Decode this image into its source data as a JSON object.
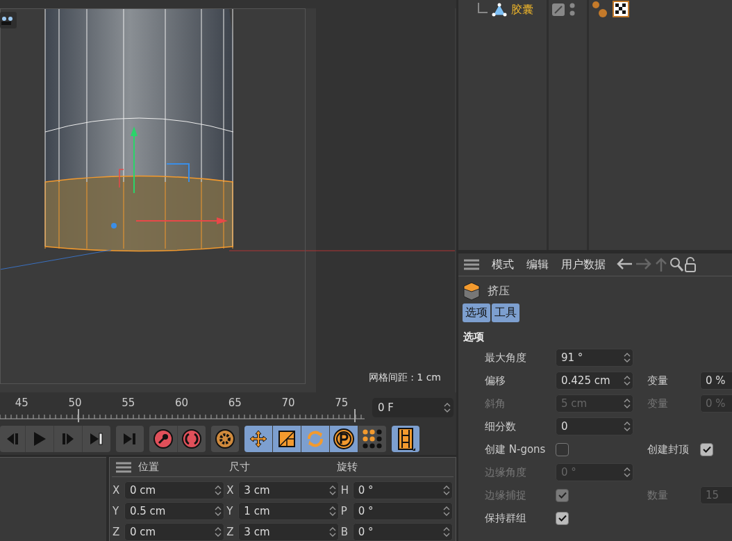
{
  "object_manager": {
    "object": {
      "name": "胶囊"
    }
  },
  "viewport": {
    "grid_label": "网格间距 : 1 cm"
  },
  "timeline": {
    "ticks": [
      "45",
      "50",
      "55",
      "60",
      "65",
      "70",
      "75"
    ],
    "frame_field": "0 F"
  },
  "transport": {
    "groups": [
      [
        {
          "kind": "prev-key",
          "selected": false
        },
        {
          "kind": "play",
          "selected": false
        },
        {
          "kind": "next-key",
          "selected": false
        },
        {
          "kind": "goto-end",
          "selected": false
        }
      ],
      [
        {
          "kind": "goto-last",
          "selected": false
        }
      ],
      [
        {
          "kind": "record-key",
          "selected": false
        },
        {
          "kind": "auto-key",
          "selected": false
        }
      ],
      [
        {
          "kind": "gear",
          "selected": false
        }
      ],
      [
        {
          "kind": "move",
          "selected": true
        },
        {
          "kind": "scale",
          "selected": true
        },
        {
          "kind": "rotate",
          "selected": true
        },
        {
          "kind": "param",
          "selected": true
        },
        {
          "kind": "points",
          "selected": false
        }
      ],
      [
        {
          "kind": "film",
          "selected": true
        }
      ]
    ]
  },
  "coordinates": {
    "headers": [
      "位置",
      "尺寸",
      "旋转"
    ],
    "rows": [
      [
        {
          "axis": "X",
          "value": "0 cm"
        },
        {
          "axis": "X",
          "value": "3 cm"
        },
        {
          "axis": "H",
          "value": "0 °"
        }
      ],
      [
        {
          "axis": "Y",
          "value": "0.5 cm"
        },
        {
          "axis": "Y",
          "value": "1 cm"
        },
        {
          "axis": "P",
          "value": "0 °"
        }
      ],
      [
        {
          "axis": "Z",
          "value": "0 cm"
        },
        {
          "axis": "Z",
          "value": "3 cm"
        },
        {
          "axis": "B",
          "value": "0 °"
        }
      ]
    ]
  },
  "attributes": {
    "menu": [
      "模式",
      "编辑",
      "用户数据"
    ],
    "object_name": "挤压",
    "tabs": [
      {
        "label": "选项",
        "selected": true
      },
      {
        "label": "工具",
        "selected": true
      }
    ],
    "section": "选项",
    "rows": [
      {
        "left": {
          "kind": "number",
          "label": "最大角度",
          "value": "91 °",
          "disabled": false
        }
      },
      {
        "left": {
          "kind": "number",
          "label": "偏移",
          "value": "0.425 cm",
          "disabled": false
        },
        "right": {
          "kind": "number",
          "label": "变量",
          "value": "0 %",
          "disabled": false
        }
      },
      {
        "left": {
          "kind": "number",
          "label": "斜角",
          "value": "5 cm",
          "disabled": true
        },
        "right": {
          "kind": "number",
          "label": "变量",
          "value": "0 %",
          "disabled": true
        }
      },
      {
        "left": {
          "kind": "number",
          "label": "细分数",
          "value": "0",
          "disabled": false
        }
      },
      {
        "left": {
          "kind": "checkbox",
          "label": "创建 N-gons",
          "checked": false,
          "disabled": false
        },
        "right": {
          "kind": "checkbox",
          "label": "创建封顶",
          "checked": true,
          "disabled": false
        }
      },
      {
        "left": {
          "kind": "number",
          "label": "边缘角度",
          "value": "0 °",
          "disabled": true
        }
      },
      {
        "left": {
          "kind": "checkbox",
          "label": "边缘捕捉",
          "checked": true,
          "disabled": true
        },
        "right": {
          "kind": "number",
          "label": "数量",
          "value": "15",
          "disabled": true
        }
      },
      {
        "left": {
          "kind": "checkbox",
          "label": "保持群组",
          "checked": true,
          "disabled": false
        }
      }
    ]
  }
}
